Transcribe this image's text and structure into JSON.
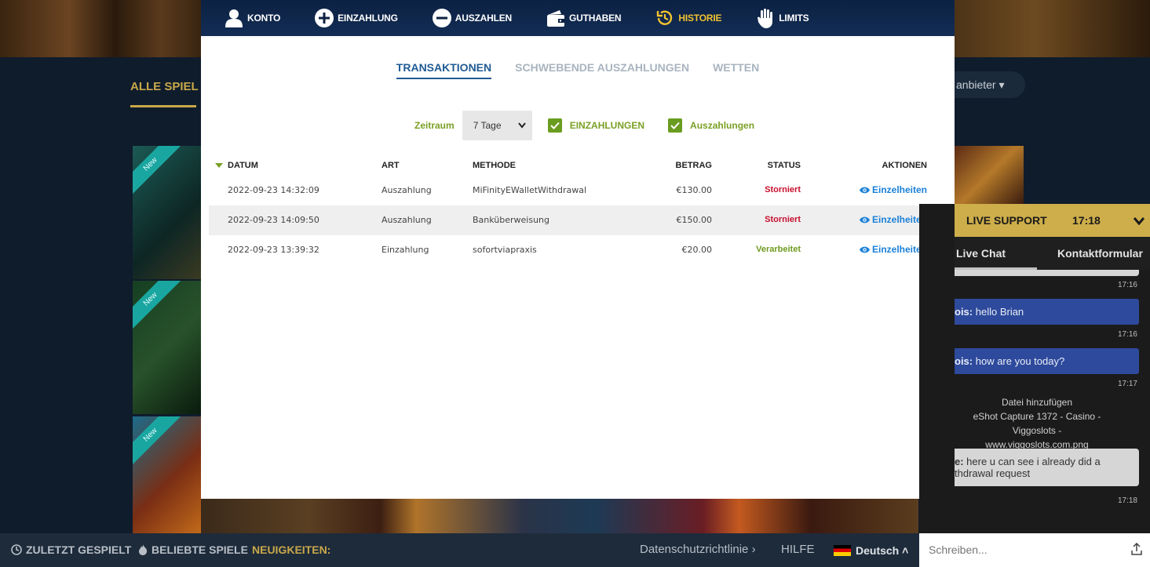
{
  "background": {
    "tab_all_games": "ALLE SPIEL",
    "provider_filter": "anbieter",
    "new_badge": "New"
  },
  "nav": [
    {
      "label": "KONTO",
      "icon": "user-icon"
    },
    {
      "label": "EINZAHLUNG",
      "icon": "plus-circle-icon"
    },
    {
      "label": "AUSZAHLEN",
      "icon": "minus-circle-icon"
    },
    {
      "label": "GUTHABEN",
      "icon": "wallet-icon"
    },
    {
      "label": "HISTORIE",
      "icon": "history-icon",
      "active": true
    },
    {
      "label": "LIMITS",
      "icon": "hand-icon"
    }
  ],
  "subtabs": [
    {
      "label": "TRANSAKTIONEN",
      "active": true
    },
    {
      "label": "SCHWEBENDE AUSZAHLUNGEN"
    },
    {
      "label": "WETTEN"
    }
  ],
  "filters": {
    "period_label": "Zeitraum",
    "period_value": "7 Tage",
    "deposits_label": "EINZAHLUNGEN",
    "deposits_checked": true,
    "withdrawals_label": "Auszahlungen",
    "withdrawals_checked": true
  },
  "table": {
    "headers": {
      "date": "DATUM",
      "type": "ART",
      "method": "METHODE",
      "amount": "BETRAG",
      "status": "STATUS",
      "actions": "AKTIONEN"
    },
    "rows": [
      {
        "date": "2022-09-23 14:32:09",
        "type": "Auszahlung",
        "method": "MiFinityEWalletWithdrawal",
        "amount": "€130.00",
        "status": "Storniert",
        "action": "Einzelheiten"
      },
      {
        "date": "2022-09-23 14:09:50",
        "type": "Auszahlung",
        "method": "Banküberweisung",
        "amount": "€150.00",
        "status": "Storniert",
        "action": "Einzelheiten"
      },
      {
        "date": "2022-09-23 13:39:32",
        "type": "Einzahlung",
        "method": "sofortviapraxis",
        "amount": "€20.00",
        "status": "Verarbeitet",
        "action": "Einzelheiten"
      }
    ]
  },
  "colors": {
    "nav_bg": "#0c2142",
    "active_nav": "#f2c230",
    "green": "#7aa024",
    "cancelled": "#c8102e",
    "processed": "#6e9a1e",
    "link_blue": "#1a80d8",
    "support_gold": "#cdae4a"
  },
  "support": {
    "title": "LIVE SUPPORT",
    "time": "17:18",
    "tab_chat": "Live Chat",
    "tab_form": "Kontaktformular",
    "ts1": "17:16",
    "msg1_sender": "ois:",
    "msg1_text": " hello Brian",
    "ts2": "17:16",
    "msg2_sender": "ois:",
    "msg2_text": " how are you today?",
    "ts3": "17:17",
    "file_line1": "Datei hinzufügen",
    "file_line2": "eShot Capture 1372 - Casino - Viggoslots -",
    "file_line3": "www.viggoslots.com.png",
    "msg3_sender": "e:",
    "msg3_text": " here u can see i already did a",
    "msg3_text2": "thdrawal request",
    "ts4": "17:18",
    "input_placeholder": "Schreiben..."
  },
  "bottom_bar": {
    "recent": "ZULETZT GESPIELT",
    "popular": "BELIEBTE SPIELE",
    "news": "NEUIGKEITEN:",
    "privacy": "Datenschutzrichtlinie",
    "help": "HILFE",
    "language": "Deutsch"
  }
}
